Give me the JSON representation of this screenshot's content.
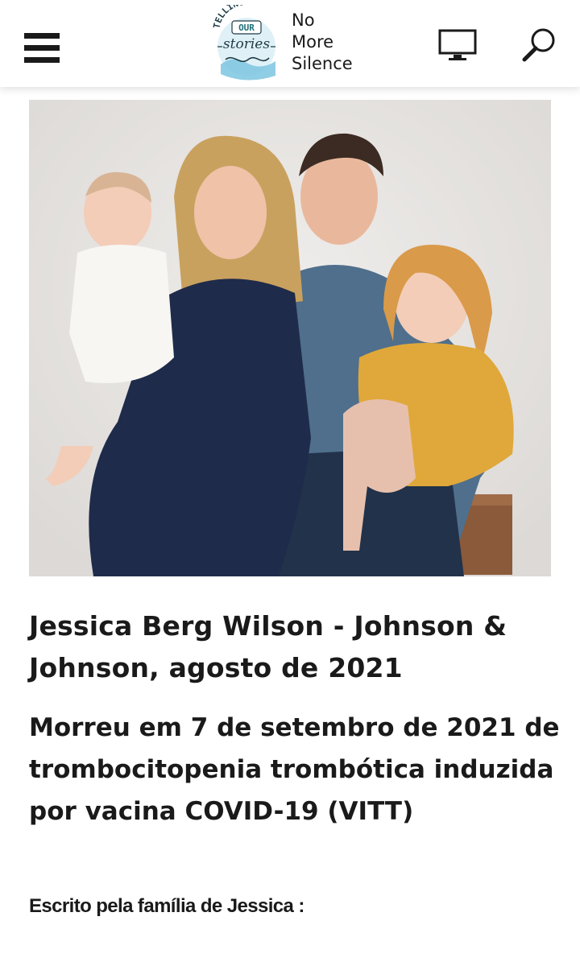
{
  "header": {
    "menu_icon": "hamburger-menu-icon",
    "logo": {
      "badge_top": "TELLING",
      "badge_mid": "OUR",
      "badge_script": "stories",
      "lines": [
        "No",
        "More",
        "Silence"
      ]
    },
    "monitor_icon": "monitor-icon",
    "search_icon": "search-icon"
  },
  "article": {
    "photo_icon": "family-photo",
    "title": "Jessica Berg Wilson - Johnson & Johnson, agosto de 2021",
    "subtitle": "Morreu em 7 de setembro de 2021 de trombocitopenia trombótica induzida por vacina COVID-19 (VITT)",
    "byline": "Escrito pela família de Jessica :"
  },
  "colors": {
    "text": "#1a1a1a",
    "logo_accent": "#1f6f7a",
    "logo_water": "#7cc6e0",
    "photo_bg": "#e6e4e2"
  }
}
